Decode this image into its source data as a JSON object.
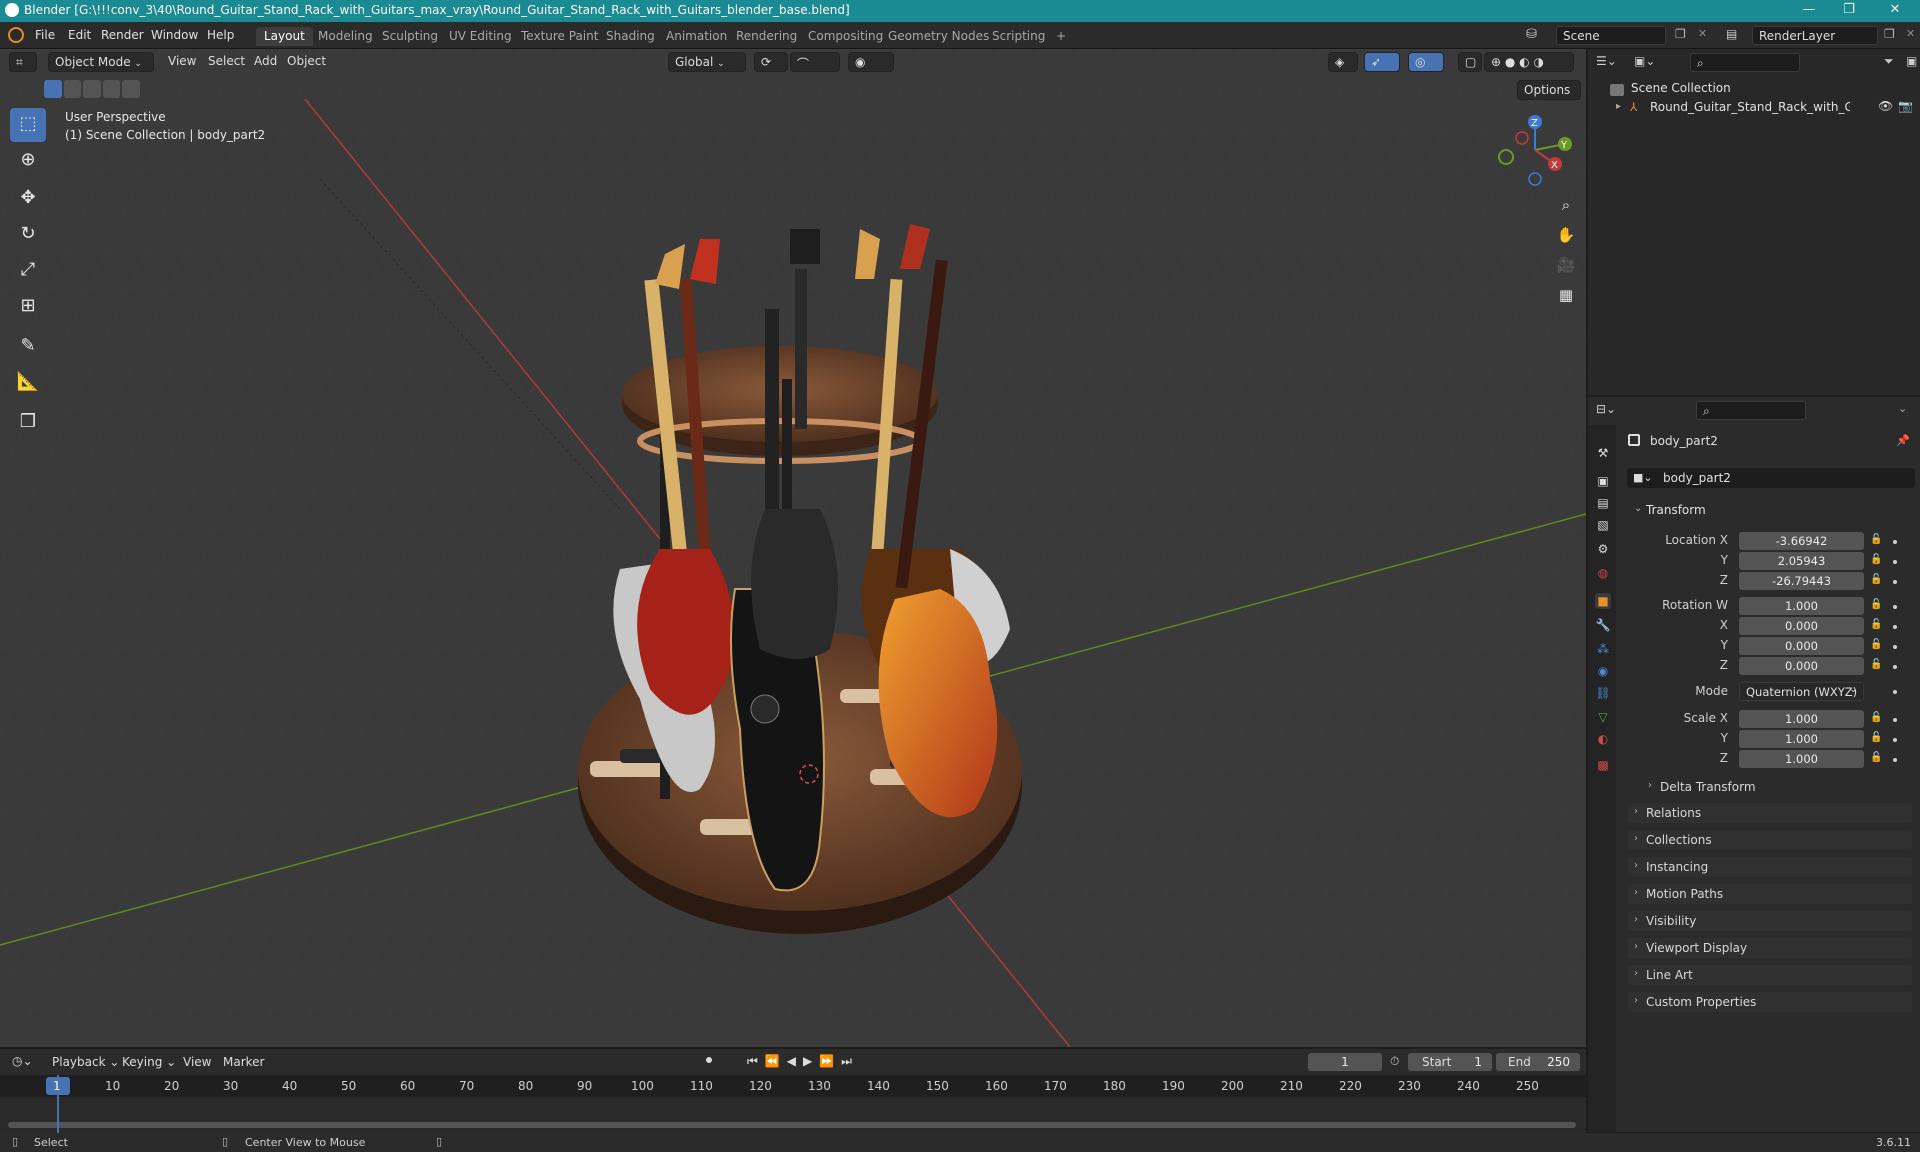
{
  "titlebar": {
    "title": "Blender [G:\\!!!conv_3\\40\\Round_Guitar_Stand_Rack_with_Guitars_max_vray\\Round_Guitar_Stand_Rack_with_Guitars_blender_base.blend]",
    "minimize": "—",
    "restore": "❐",
    "close": "✕"
  },
  "menu": {
    "file": "File",
    "edit": "Edit",
    "render": "Render",
    "window": "Window",
    "help": "Help"
  },
  "workspaces": [
    "Layout",
    "Modeling",
    "Sculpting",
    "UV Editing",
    "Texture Paint",
    "Shading",
    "Animation",
    "Rendering",
    "Compositing",
    "Geometry Nodes",
    "Scripting"
  ],
  "workspace_add": "+",
  "scene": {
    "name": "Scene",
    "render_layer": "RenderLayer"
  },
  "viewport_header": {
    "mode": "Object Mode",
    "view": "View",
    "select": "Select",
    "add": "Add",
    "object": "Object",
    "transform_orientation": "Global",
    "options": "Options"
  },
  "viewport_overlay": {
    "perspective": "User Perspective",
    "collection_info": "(1) Scene Collection | body_part2"
  },
  "gizmo": {
    "z": "Z",
    "y": "Y",
    "x": "X"
  },
  "outliner": {
    "root": "Scene Collection",
    "item": "Round_Guitar_Stand_Rack_with_Guitars"
  },
  "properties": {
    "object_name": "body_part2",
    "data_name": "body_part2",
    "transform_label": "Transform",
    "location": {
      "label": "Location X",
      "x": "-3.66942",
      "y": "2.05943",
      "z": "-26.79443"
    },
    "rotation": {
      "label": "Rotation W",
      "w": "1.000",
      "x": "0.000",
      "y": "0.000",
      "z": "0.000"
    },
    "mode_label": "Mode",
    "mode_value": "Quaternion (WXYZ)",
    "scale": {
      "label": "Scale X",
      "x": "1.000",
      "y": "1.000",
      "z": "1.000"
    },
    "axis_y": "Y",
    "axis_z": "Z",
    "axis_x": "X",
    "delta_transform": "Delta Transform",
    "panels": [
      "Relations",
      "Collections",
      "Instancing",
      "Motion Paths",
      "Visibility",
      "Viewport Display",
      "Line Art",
      "Custom Properties"
    ]
  },
  "timeline": {
    "playback": "Playback",
    "keying": "Keying",
    "view": "View",
    "marker": "Marker",
    "current_frame": "1",
    "start_label": "Start",
    "start": "1",
    "end_label": "End",
    "end": "250",
    "ruler": [
      "1",
      "10",
      "20",
      "30",
      "40",
      "50",
      "60",
      "70",
      "80",
      "90",
      "100",
      "110",
      "120",
      "130",
      "140",
      "150",
      "160",
      "170",
      "180",
      "190",
      "200",
      "210",
      "220",
      "230",
      "240",
      "250"
    ]
  },
  "statusbar": {
    "select": "Select",
    "center_view": "Center View to Mouse",
    "version": "3.6.11"
  },
  "colors": {
    "accent": "#4772b3",
    "titlebar": "#1a8a93",
    "x_axis": "#c43a3a",
    "y_axis": "#6a9a23"
  }
}
